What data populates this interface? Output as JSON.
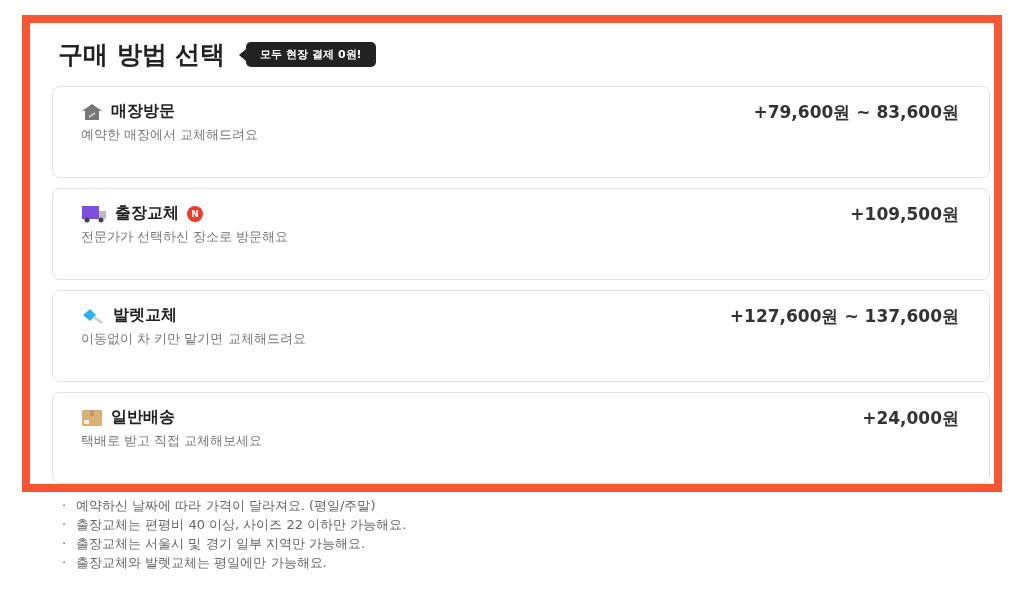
{
  "title": "구매 방법 선택",
  "tooltip": "모두 현장 결제 0원!",
  "options": [
    {
      "kind": "store",
      "name": "매장방문",
      "description": "예약한 매장에서 교체해드려요",
      "price": "+79,600원 ~ 83,600원"
    },
    {
      "kind": "delivery",
      "name": "출장교체",
      "badge": "N",
      "description": "전문가가 선택하신 장소로 방문해요",
      "price": "+109,500원"
    },
    {
      "kind": "valet",
      "name": "발렛교체",
      "description": "이동없이 차 키만 맡기면 교체해드려요",
      "price": "+127,600원 ~ 137,600원"
    },
    {
      "kind": "parcel",
      "name": "일반배송",
      "description": "택배로 받고 직접 교체해보세요",
      "price": "+24,000원"
    }
  ],
  "notes": [
    {
      "bullet": "·",
      "text": "예약하신 날짜에 따라 가격이 달라져요. (평일/주말)"
    },
    {
      "bullet": "·",
      "text": "출장교체는 편평비 40 이상, 사이즈 22 이하만 가능해요."
    },
    {
      "bullet": "·",
      "text": "출장교체는 서울시 및 경기 일부 지역만 가능해요."
    },
    {
      "bullet": "·",
      "text": "출장교체와 발렛교체는 평일에만 가능해요."
    }
  ]
}
